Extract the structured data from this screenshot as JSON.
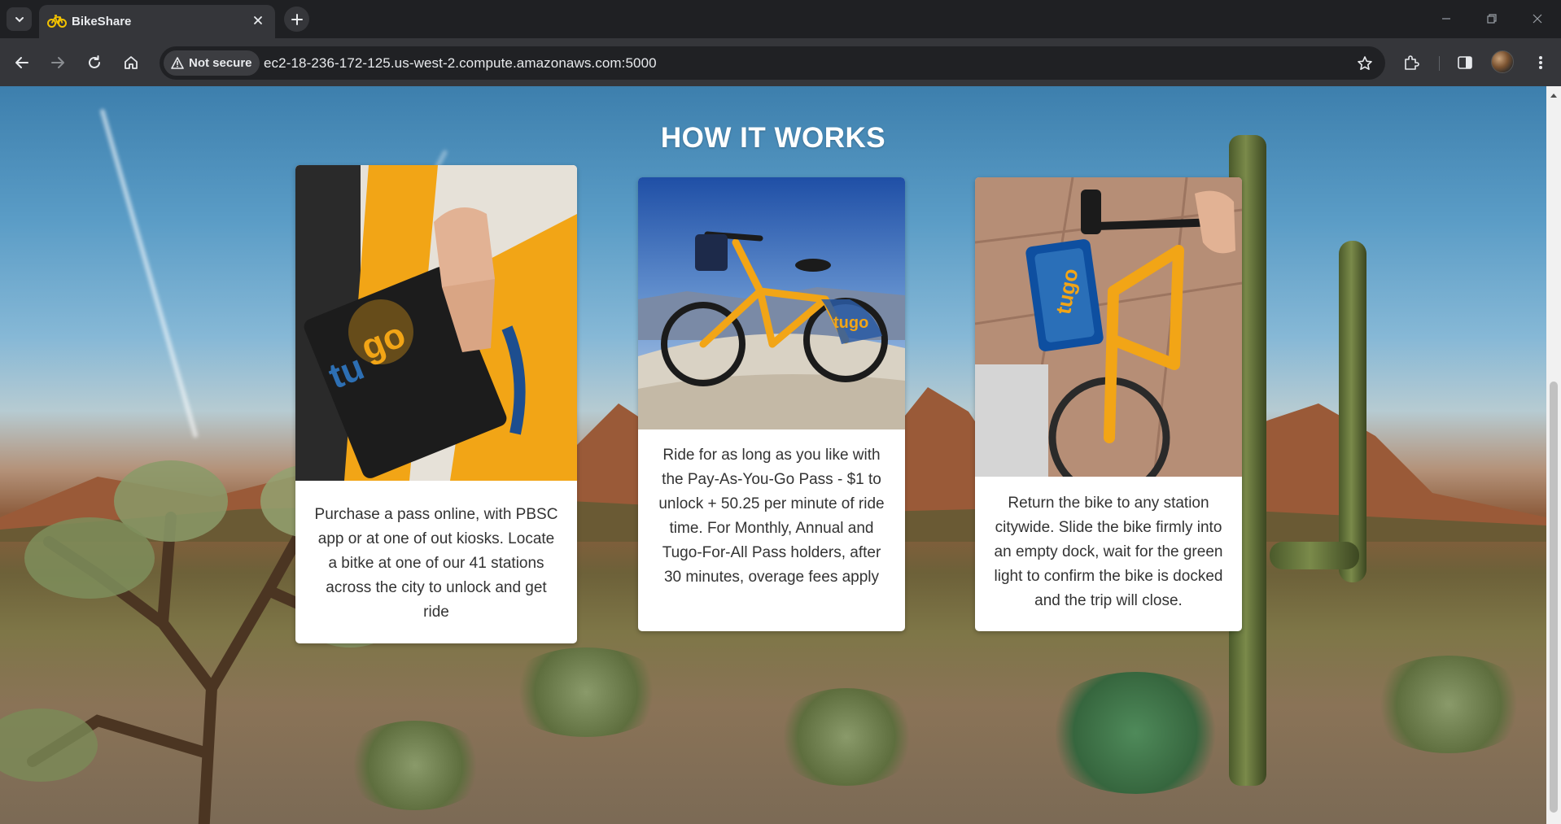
{
  "browser": {
    "tab": {
      "title": "BikeShare",
      "favicon": "bicycle-icon"
    },
    "security": {
      "label": "Not secure",
      "icon": "warning-triangle-icon"
    },
    "url": "ec2-18-236-172-125.us-west-2.compute.amazonaws.com:5000",
    "colors": {
      "tabstrip": "#1f2023",
      "toolbar": "#35363a",
      "omnibox": "#202124"
    }
  },
  "page": {
    "section_title": "HOW IT WORKS",
    "cards": [
      {
        "image": "hand-holding-tugo-pass-card",
        "text": "Purchase a pass online, with PBSC app or at one of out kiosks. Locate a bitke at one of our 41 stations across the city to unlock and get ride"
      },
      {
        "image": "tugo-bike-on-mountain-rock",
        "text": "Ride for as long as you like with the Pay-As-You-Go Pass - $1 to unlock + 50.25 per minute of ride time. For Monthly, Annual and Tugo-For-All Pass holders, after 30 minutes, overage fees apply"
      },
      {
        "image": "tugo-bike-docked-at-station",
        "text": "Return the bike to any station citywide. Slide the bike firmly into an empty dock, wait for the green light to confirm the bike is docked and the trip will close."
      }
    ],
    "brand_colors": {
      "bike_orange": "#f2a516",
      "tugo_blue": "#1d4e8f"
    }
  }
}
